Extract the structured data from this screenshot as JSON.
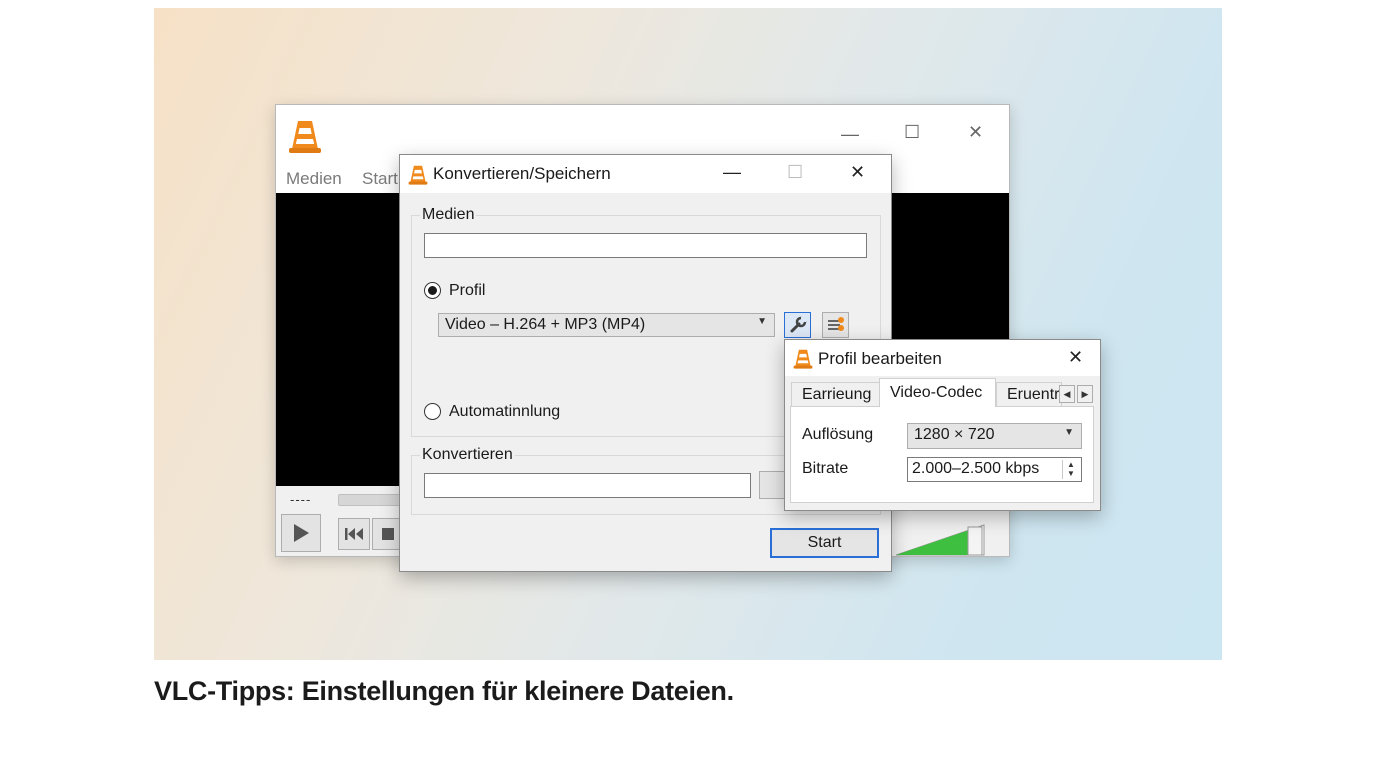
{
  "caption": "VLC-Tipps: Einstellungen für kleinere Dateien.",
  "main_window": {
    "menu": [
      "Medien",
      "Start"
    ],
    "time_display": "----",
    "colors": {
      "cone_orange": "#f08a1c",
      "volume_green": "#3fbf3f"
    }
  },
  "convert_dialog": {
    "title": "Konvertieren/Speichern",
    "media_group_label": "Medien",
    "media_input_value": "",
    "profile_radio_label": "Profil",
    "profile_selected": true,
    "profile_combo_value": "Video – H.264 + MP3 (MP4)",
    "auto_radio_label": "Automatinnlung",
    "convert_group_label": "Konvertieren",
    "convert_input_value": "",
    "start_button": "Start",
    "icons": [
      "wrench-icon",
      "edit-profile-icon"
    ]
  },
  "profile_dialog": {
    "title": "Profil bearbeiten",
    "tabs": [
      "Earrieung",
      "Video-Codec",
      "Eruentr"
    ],
    "selected_tab": "Video-Codec",
    "resolution_label": "Auflösung",
    "resolution_value": "1280 × 720",
    "bitrate_label": "Bitrate",
    "bitrate_value": "2.000–2.500 kbps"
  }
}
